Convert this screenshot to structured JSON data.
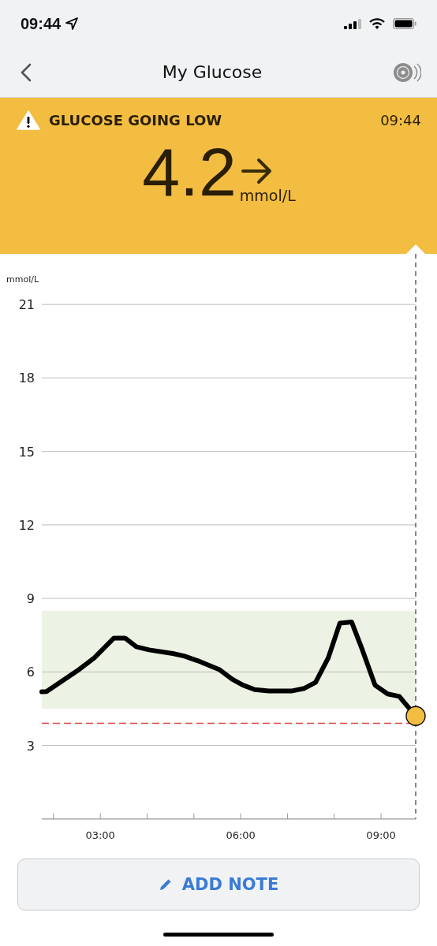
{
  "status_bar": {
    "time": "09:44"
  },
  "nav": {
    "title": "My Glucose"
  },
  "alert": {
    "title": "GLUCOSE GOING LOW",
    "time": "09:44",
    "value": "4.2",
    "unit": "mmol/L"
  },
  "chart": {
    "chart_data": {
      "type": "line",
      "ylabel": "mmol/L",
      "x": [
        1.75,
        1.85,
        2.51,
        2.87,
        3.29,
        3.53,
        3.77,
        4.04,
        4.55,
        4.79,
        5.09,
        5.54,
        5.82,
        6.05,
        6.3,
        6.6,
        7.08,
        7.36,
        7.6,
        7.87,
        8.12,
        8.37,
        8.6,
        8.87,
        9.14,
        9.39,
        9.74
      ],
      "series": [
        {
          "color": "#000000",
          "values": [
            5.19,
            5.2,
            6.05,
            6.57,
            7.38,
            7.38,
            7.03,
            6.9,
            6.75,
            6.65,
            6.45,
            6.1,
            5.7,
            5.46,
            5.28,
            5.22,
            5.22,
            5.33,
            5.57,
            6.57,
            7.99,
            8.04,
            6.9,
            5.46,
            5.1,
            5.0,
            4.2
          ]
        }
      ],
      "xlim": [
        1.75,
        9.74
      ],
      "ylim": [
        0,
        23
      ],
      "xticks": [
        {
          "value": 3,
          "label": "03:00"
        },
        {
          "value": 6,
          "label": "06:00"
        },
        {
          "value": 9,
          "label": "09:00"
        }
      ],
      "yticks": [
        3,
        6,
        9,
        12,
        15,
        18,
        21
      ],
      "grid": true,
      "bands": [
        {
          "axis": "y",
          "from": 4.5,
          "to": 8.5,
          "color": "#edf3e4"
        }
      ],
      "ref_lines": [
        {
          "axis": "y",
          "value": 3.9,
          "color": "#e0413f"
        }
      ]
    }
  },
  "add_note_button": {
    "label": "ADD NOTE"
  }
}
